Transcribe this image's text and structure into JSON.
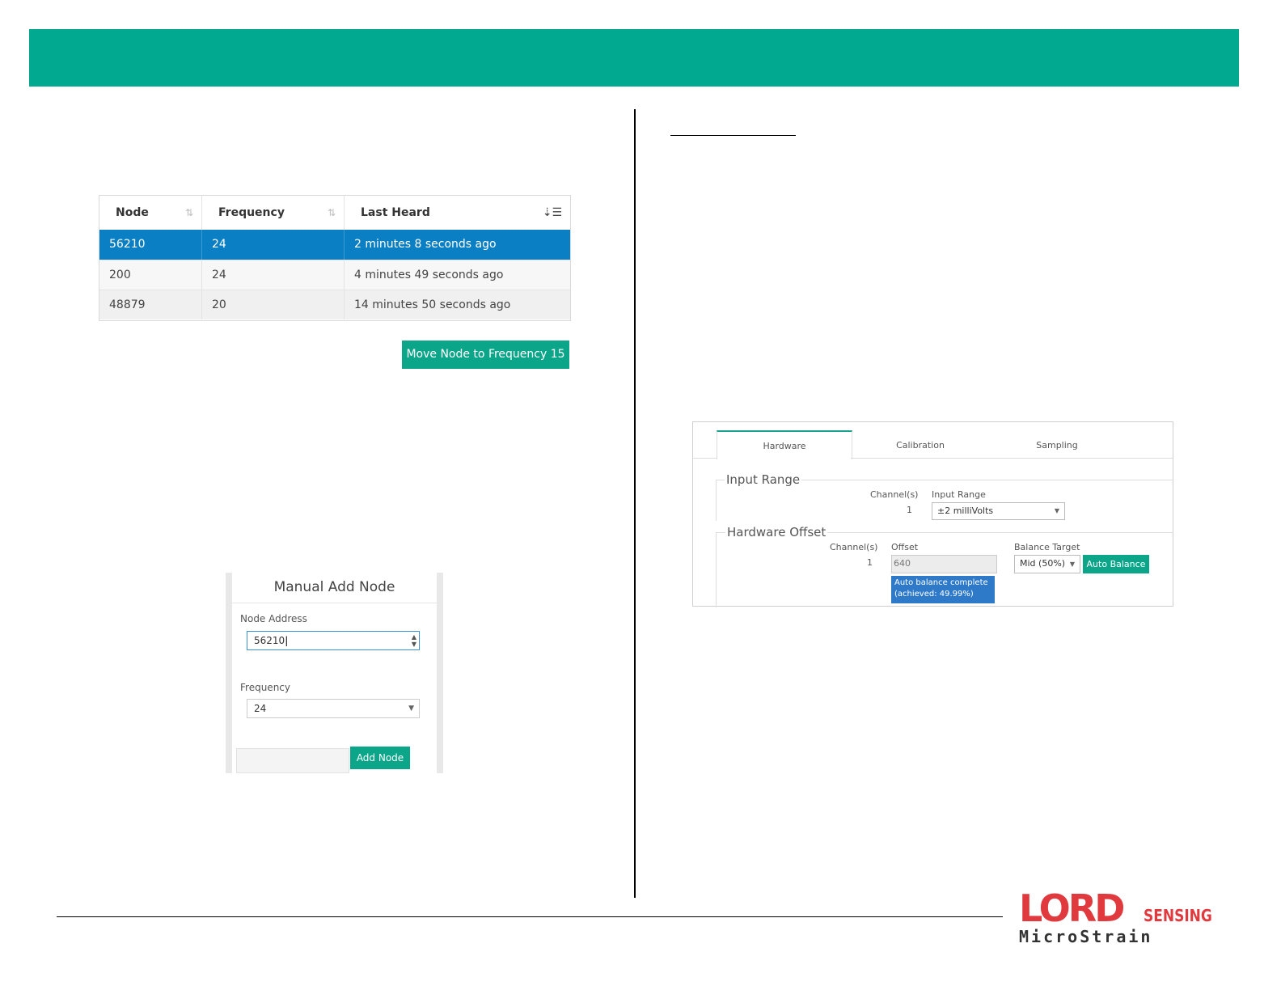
{
  "node_table": {
    "headers": [
      "Node",
      "Frequency",
      "Last Heard"
    ],
    "rows": [
      {
        "node": "56210",
        "frequency": "24",
        "last_heard": "2 minutes 8 seconds ago",
        "selected": true
      },
      {
        "node": "200",
        "frequency": "24",
        "last_heard": "4 minutes 49 seconds ago"
      },
      {
        "node": "48879",
        "frequency": "20",
        "last_heard": "14 minutes 50 seconds ago"
      }
    ],
    "move_button": "Move Node to Frequency 15"
  },
  "manual_add": {
    "title": "Manual Add Node",
    "node_address_label": "Node Address",
    "node_address_value": "56210",
    "frequency_label": "Frequency",
    "frequency_value": "24",
    "add_button": "Add Node"
  },
  "hardware_panel": {
    "tabs": [
      "Hardware",
      "Calibration",
      "Sampling"
    ],
    "active_tab": "Hardware",
    "input_range": {
      "legend": "Input Range",
      "channels_header": "Channel(s)",
      "range_header": "Input Range",
      "channel": "1",
      "range_value": "±2 milliVolts"
    },
    "hardware_offset": {
      "legend": "Hardware Offset",
      "channels_header": "Channel(s)",
      "offset_header": "Offset",
      "balance_header": "Balance Target",
      "channel": "1",
      "offset_value": "640",
      "balance_value": "Mid (50%)",
      "auto_balance_button": "Auto Balance",
      "tooltip_line1": "Auto balance complete",
      "tooltip_line2": "(achieved: 49.99%)"
    }
  },
  "logo": {
    "lord": "LORD",
    "sensing": "SENSING",
    "microstrain": "MicroStrain"
  },
  "colors": {
    "banner": "#00a98f",
    "selected_row": "#0a7fc4",
    "button": "#0ba68a",
    "logo_red": "#e03a3e"
  }
}
